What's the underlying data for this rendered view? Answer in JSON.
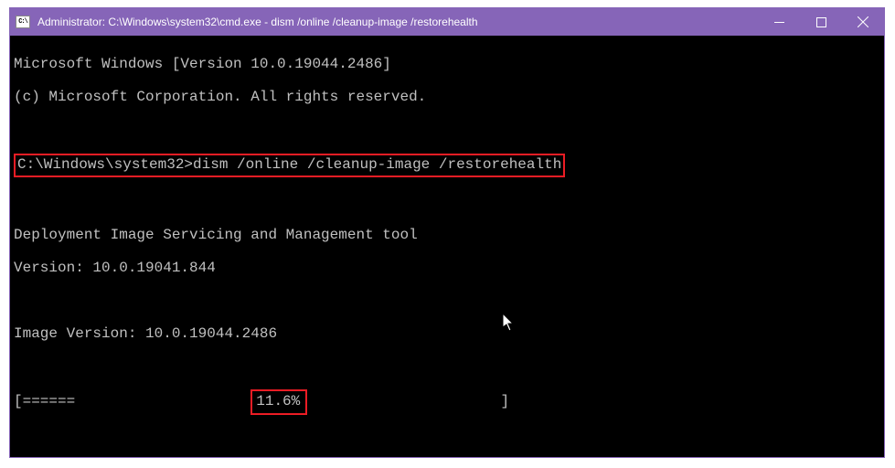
{
  "window": {
    "title": "Administrator: C:\\Windows\\system32\\cmd.exe - dism  /online /cleanup-image /restorehealth"
  },
  "terminal": {
    "banner_line1": "Microsoft Windows [Version 10.0.19044.2486]",
    "banner_line2": "(c) Microsoft Corporation. All rights reserved.",
    "prompt": "C:\\Windows\\system32>",
    "command": "dism /online /cleanup-image /restorehealth",
    "tool_title": "Deployment Image Servicing and Management tool",
    "tool_version": "Version: 10.0.19041.844",
    "image_version": "Image Version: 10.0.19044.2486",
    "progress_left": "[======",
    "progress_percent": "11.6%",
    "progress_right": "] "
  }
}
